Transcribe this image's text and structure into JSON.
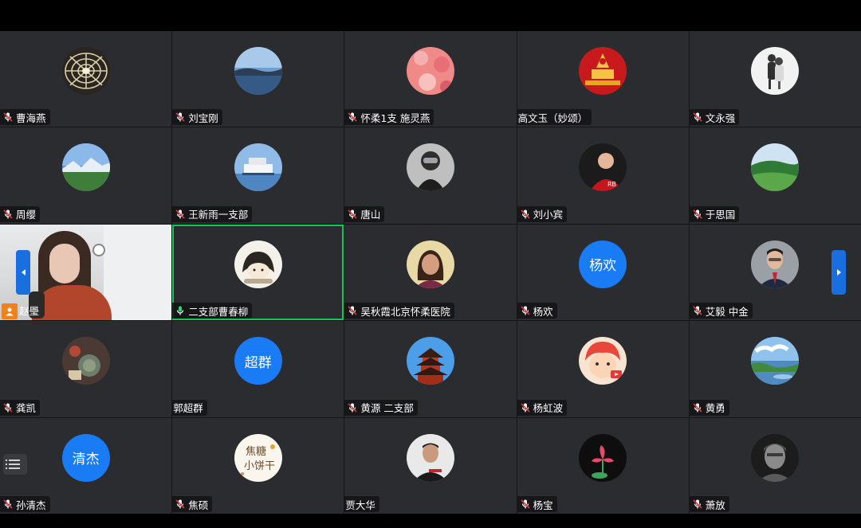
{
  "colors": {
    "accent": "#1a7cf5",
    "active_border": "#17c45a",
    "muted_mic": "#e03a3a"
  },
  "participants": [
    {
      "name": "曹海燕",
      "mic": "muted",
      "avatar": "tunnel-photo"
    },
    {
      "name": "刘宝刚",
      "mic": "muted",
      "avatar": "lake-photo"
    },
    {
      "name": "怀柔1支 施灵燕",
      "mic": "muted",
      "avatar": "flowers-photo"
    },
    {
      "name": "高文玉（妙颂）",
      "mic": "none",
      "avatar": "party-emblem"
    },
    {
      "name": "文永强",
      "mic": "muted",
      "avatar": "couple-photo"
    },
    {
      "name": "周缨",
      "mic": "muted",
      "avatar": "mountain-photo"
    },
    {
      "name": "王新雨一支部",
      "mic": "muted",
      "avatar": "boat-photo"
    },
    {
      "name": "唐山",
      "mic": "muted",
      "avatar": "astronaut-photo"
    },
    {
      "name": "刘小宾",
      "mic": "muted",
      "avatar": "player-photo"
    },
    {
      "name": "于思国",
      "mic": "muted",
      "avatar": "golf-photo"
    },
    {
      "name": "赵璺",
      "mic": "video",
      "avatar": "camera-feed"
    },
    {
      "name": "二支部曹春柳",
      "mic": "speaking",
      "avatar": "cartoon-girl"
    },
    {
      "name": "吴秋霞北京怀柔医院",
      "mic": "muted",
      "avatar": "woman-photo"
    },
    {
      "name": "杨欢",
      "mic": "muted",
      "avatar_text": "杨欢"
    },
    {
      "name": "艾毅 中金",
      "mic": "muted",
      "avatar": "man-suit-photo"
    },
    {
      "name": "龚凯",
      "mic": "muted",
      "avatar": "food-photo"
    },
    {
      "name": "郭超群",
      "mic": "none",
      "avatar_text": "超群"
    },
    {
      "name": "黄源 二支部",
      "mic": "muted",
      "avatar": "pagoda-photo"
    },
    {
      "name": "杨虹波",
      "mic": "muted",
      "avatar": "cartoon-boy"
    },
    {
      "name": "黄勇",
      "mic": "muted",
      "avatar": "wetland-photo"
    },
    {
      "name": "孙清杰",
      "mic": "muted",
      "avatar_text": "清杰"
    },
    {
      "name": "焦硕",
      "mic": "muted",
      "avatar": "cookie-text",
      "avatar_caption": "焦糖小饼干"
    },
    {
      "name": "贾大华",
      "mic": "none",
      "avatar": "man-photo"
    },
    {
      "name": "杨宝",
      "mic": "muted",
      "avatar": "lotus-art"
    },
    {
      "name": "萧放",
      "mic": "muted",
      "avatar": "sketch-portrait"
    }
  ]
}
